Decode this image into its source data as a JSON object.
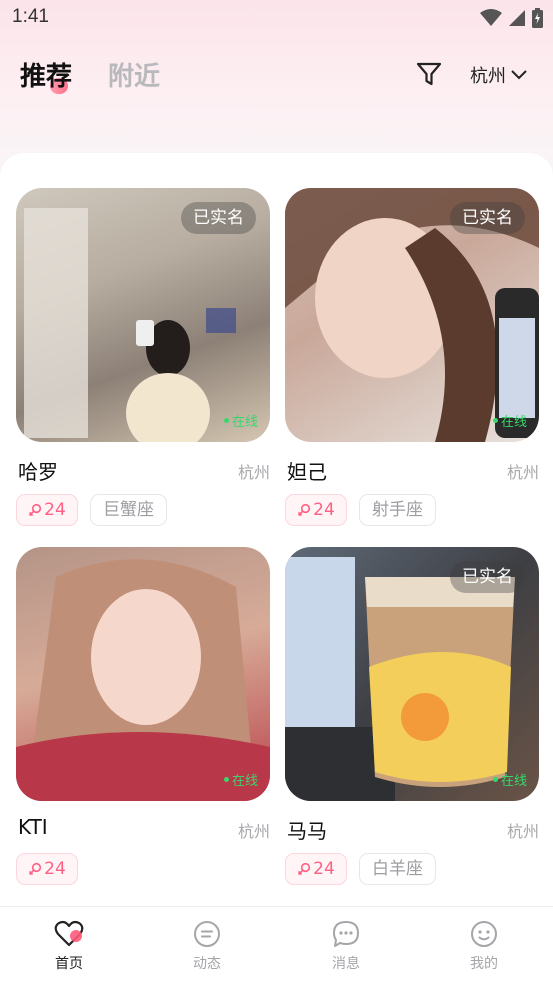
{
  "status_bar": {
    "time": "1:41"
  },
  "header": {
    "tabs": [
      {
        "label": "推荐",
        "active": true
      },
      {
        "label": "附近",
        "active": false
      }
    ],
    "city": "杭州"
  },
  "cards": [
    {
      "name": "哈罗",
      "city": "杭州",
      "verified_label": "已实名",
      "online_label": "在线",
      "age": "24",
      "zodiac": "巨蟹座"
    },
    {
      "name": "妲己",
      "city": "杭州",
      "verified_label": "已实名",
      "online_label": "在线",
      "age": "24",
      "zodiac": "射手座"
    },
    {
      "name": "KTI",
      "city": "杭州",
      "online_label": "在线",
      "age": "24"
    },
    {
      "name": "马马",
      "city": "杭州",
      "verified_label": "已实名",
      "online_label": "在线",
      "age": "24",
      "zodiac": "白羊座"
    }
  ],
  "bottom_nav": [
    {
      "label": "首页",
      "icon": "heart-icon",
      "active": true
    },
    {
      "label": "动态",
      "icon": "dynamics-icon",
      "active": false
    },
    {
      "label": "消息",
      "icon": "chat-bubble-icon",
      "active": false
    },
    {
      "label": "我的",
      "icon": "smiley-icon",
      "active": false
    }
  ],
  "colors": {
    "accent": "#ff5a7a",
    "online": "#3ad66b",
    "muted": "#a8a8ac"
  }
}
